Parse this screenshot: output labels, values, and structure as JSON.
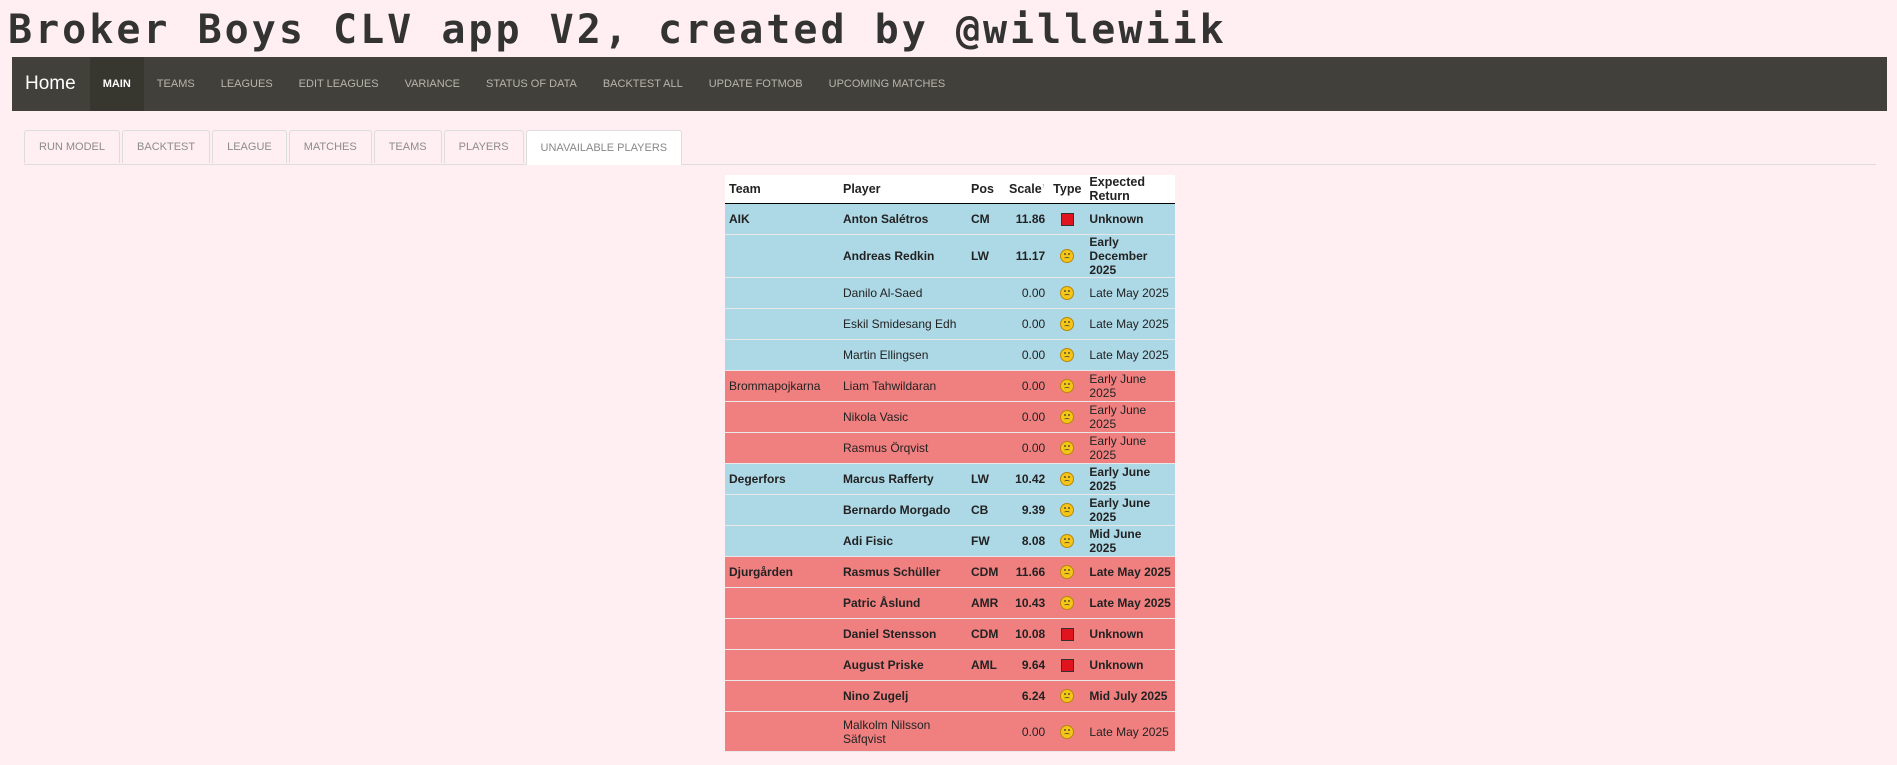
{
  "app_title": "Broker Boys CLV app V2, created by @willewiik",
  "nav": {
    "brand": "Home",
    "items": [
      "MAIN",
      "TEAMS",
      "LEAGUES",
      "EDIT LEAGUES",
      "VARIANCE",
      "STATUS OF DATA",
      "BACKTEST ALL",
      "UPDATE FOTMOB",
      "UPCOMING MATCHES"
    ],
    "active": "MAIN"
  },
  "tabs": {
    "items": [
      "RUN MODEL",
      "BACKTEST",
      "LEAGUE",
      "MATCHES",
      "TEAMS",
      "PLAYERS",
      "UNAVAILABLE PLAYERS"
    ],
    "active": "UNAVAILABLE PLAYERS"
  },
  "table": {
    "columns": {
      "team": "Team",
      "player": "Player",
      "pos": "Pos",
      "scale": "Scale",
      "scale_sup": "↑",
      "type": "Type",
      "expected_return": "Expected Return"
    },
    "rows": [
      {
        "team": "AIK",
        "player": "Anton Salétros",
        "pos": "CM",
        "scale": "11.86",
        "type": "red-card",
        "ret": "Unknown",
        "bold": true,
        "color": "blue",
        "start": true,
        "tall": false
      },
      {
        "team": "",
        "player": "Andreas Redkin",
        "pos": "LW",
        "scale": "11.17",
        "type": "injury",
        "ret": "Early December 2025",
        "bold": true,
        "color": "blue",
        "start": false,
        "tall": true
      },
      {
        "team": "",
        "player": "Danilo Al-Saed",
        "pos": "",
        "scale": "0.00",
        "type": "injury",
        "ret": "Late May 2025",
        "bold": false,
        "color": "blue",
        "start": false,
        "tall": false
      },
      {
        "team": "",
        "player": "Eskil Smidesang Edh",
        "pos": "",
        "scale": "0.00",
        "type": "injury",
        "ret": "Late May 2025",
        "bold": false,
        "color": "blue",
        "start": false,
        "tall": false
      },
      {
        "team": "",
        "player": "Martin Ellingsen",
        "pos": "",
        "scale": "0.00",
        "type": "injury",
        "ret": "Late May 2025",
        "bold": false,
        "color": "blue",
        "start": false,
        "tall": false
      },
      {
        "team": "Brommapojkarna",
        "player": "Liam Tahwildaran",
        "pos": "",
        "scale": "0.00",
        "type": "injury",
        "ret": "Early June 2025",
        "bold": false,
        "color": "red",
        "start": true,
        "tall": false
      },
      {
        "team": "",
        "player": "Nikola Vasic",
        "pos": "",
        "scale": "0.00",
        "type": "injury",
        "ret": "Early June 2025",
        "bold": false,
        "color": "red",
        "start": false,
        "tall": false
      },
      {
        "team": "",
        "player": "Rasmus Örqvist",
        "pos": "",
        "scale": "0.00",
        "type": "injury",
        "ret": "Early June 2025",
        "bold": false,
        "color": "red",
        "start": false,
        "tall": false
      },
      {
        "team": "Degerfors",
        "player": "Marcus Rafferty",
        "pos": "LW",
        "scale": "10.42",
        "type": "injury",
        "ret": "Early June 2025",
        "bold": true,
        "color": "blue",
        "start": true,
        "tall": false
      },
      {
        "team": "",
        "player": "Bernardo Morgado",
        "pos": "CB",
        "scale": "9.39",
        "type": "injury",
        "ret": "Early June 2025",
        "bold": true,
        "color": "blue",
        "start": false,
        "tall": false
      },
      {
        "team": "",
        "player": "Adi Fisic",
        "pos": "FW",
        "scale": "8.08",
        "type": "injury",
        "ret": "Mid June 2025",
        "bold": true,
        "color": "blue",
        "start": false,
        "tall": false
      },
      {
        "team": "Djurgården",
        "player": "Rasmus Schüller",
        "pos": "CDM",
        "scale": "11.66",
        "type": "injury",
        "ret": "Late May 2025",
        "bold": true,
        "color": "red",
        "start": true,
        "tall": false
      },
      {
        "team": "",
        "player": "Patric Åslund",
        "pos": "AMR",
        "scale": "10.43",
        "type": "injury",
        "ret": "Late May 2025",
        "bold": true,
        "color": "red",
        "start": false,
        "tall": false
      },
      {
        "team": "",
        "player": "Daniel Stensson",
        "pos": "CDM",
        "scale": "10.08",
        "type": "red-card",
        "ret": "Unknown",
        "bold": true,
        "color": "red",
        "start": false,
        "tall": false
      },
      {
        "team": "",
        "player": "August Priske",
        "pos": "AML",
        "scale": "9.64",
        "type": "red-card",
        "ret": "Unknown",
        "bold": true,
        "color": "red",
        "start": false,
        "tall": false
      },
      {
        "team": "",
        "player": "Nino Zugelj",
        "pos": "",
        "scale": "6.24",
        "type": "injury",
        "ret": "Mid July 2025",
        "bold": true,
        "color": "red",
        "start": false,
        "tall": false
      },
      {
        "team": "",
        "player": "Malkolm Nilsson Säfqvist",
        "pos": "",
        "scale": "0.00",
        "type": "injury",
        "ret": "Late May 2025",
        "bold": false,
        "color": "red",
        "start": false,
        "tall": true
      }
    ]
  },
  "icons": {
    "red-card": "red-square-icon",
    "injury": "sad-face-icon"
  },
  "colors": {
    "blue_row": "#add8e6",
    "red_row": "#f08080",
    "navbar": "#41403b",
    "background": "#ffeef2"
  }
}
